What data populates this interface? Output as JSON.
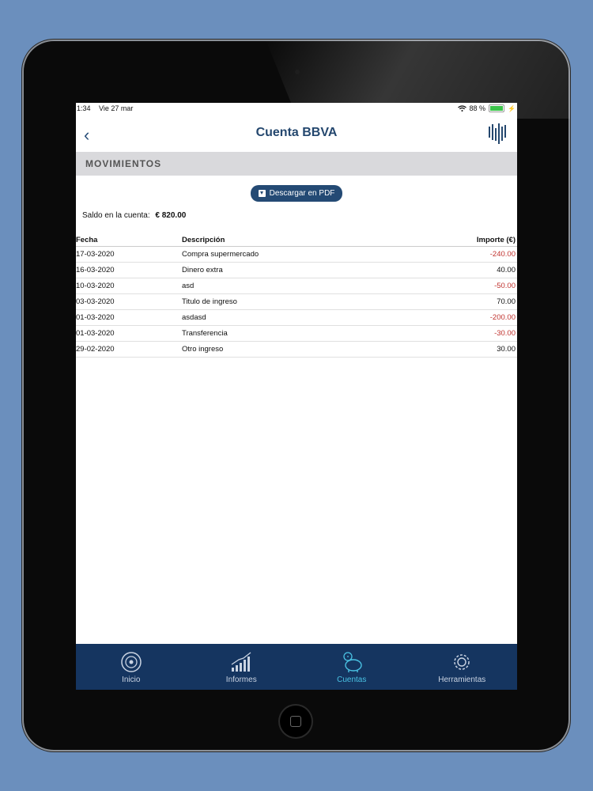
{
  "status": {
    "time": "1:34",
    "date": "Vie 27 mar",
    "battery": "88 %",
    "battery_level": 0.88
  },
  "navbar": {
    "title": "Cuenta BBVA"
  },
  "section": {
    "title": "MOVIMIENTOS"
  },
  "pdf_button": {
    "label": "Descargar en PDF"
  },
  "saldo": {
    "label": "Saldo en la cuenta:",
    "value": "€ 820.00"
  },
  "table": {
    "headers": {
      "fecha": "Fecha",
      "descripcion": "Descripción",
      "importe": "Importe (€)"
    },
    "rows": [
      {
        "fecha": "17-03-2020",
        "descripcion": "Compra supermercado",
        "importe": "-240.00",
        "negative": true
      },
      {
        "fecha": "16-03-2020",
        "descripcion": "Dinero extra",
        "importe": "40.00",
        "negative": false
      },
      {
        "fecha": "10-03-2020",
        "descripcion": "asd",
        "importe": "-50.00",
        "negative": true
      },
      {
        "fecha": "03-03-2020",
        "descripcion": "Titulo de ingreso",
        "importe": "70.00",
        "negative": false
      },
      {
        "fecha": "01-03-2020",
        "descripcion": "asdasd",
        "importe": "-200.00",
        "negative": true
      },
      {
        "fecha": "01-03-2020",
        "descripcion": "Transferencia",
        "importe": "-30.00",
        "negative": true
      },
      {
        "fecha": "29-02-2020",
        "descripcion": "Otro ingreso",
        "importe": "30.00",
        "negative": false
      }
    ]
  },
  "tabbar": {
    "items": [
      {
        "label": "Inicio",
        "icon": "home-icon",
        "active": false
      },
      {
        "label": "Informes",
        "icon": "chart-icon",
        "active": false
      },
      {
        "label": "Cuentas",
        "icon": "piggy-bank-icon",
        "active": true
      },
      {
        "label": "Herramientas",
        "icon": "gear-icon",
        "active": false
      }
    ]
  },
  "colors": {
    "primary": "#244a74",
    "tabbar": "#153560",
    "active": "#4ac2e3",
    "negative": "#c0322e"
  }
}
